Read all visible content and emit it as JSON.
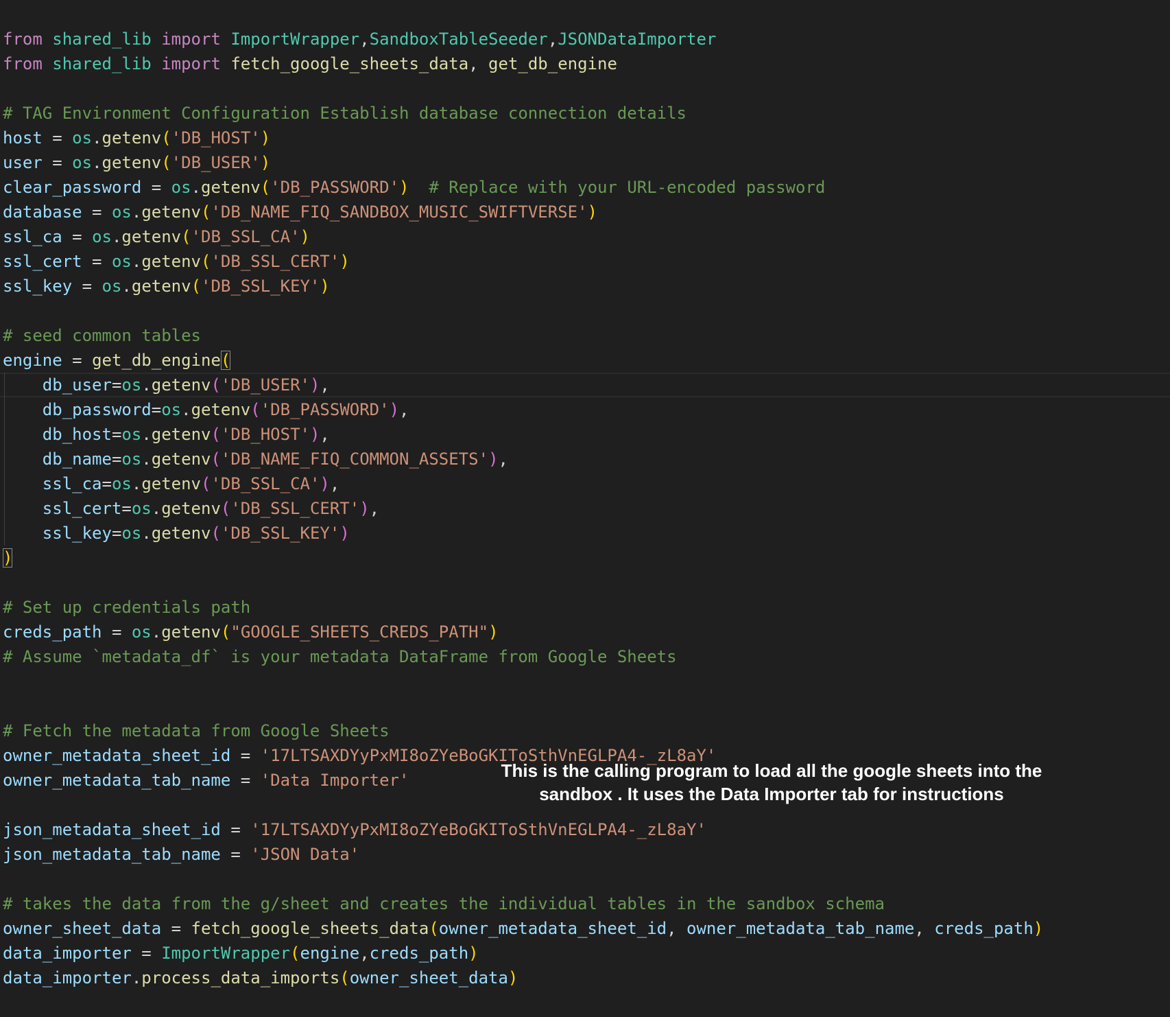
{
  "editor": {
    "colors": {
      "background": "#1f1f1f",
      "keyword": "#c586c0",
      "module": "#4ec9b0",
      "function": "#dcdcaa",
      "variable": "#9cdcfe",
      "string": "#ce9178",
      "comment": "#6a9955",
      "bracket_outer": "#ffd700",
      "bracket_inner": "#da70d6"
    },
    "lines": [
      [
        [
          "kw",
          "from"
        ],
        [
          "pl",
          " "
        ],
        [
          "mod",
          "shared_lib"
        ],
        [
          "pl",
          " "
        ],
        [
          "kw",
          "import"
        ],
        [
          "pl",
          " "
        ],
        [
          "cls",
          "ImportWrapper"
        ],
        [
          "pl",
          ","
        ],
        [
          "cls",
          "SandboxTableSeeder"
        ],
        [
          "pl",
          ","
        ],
        [
          "cls",
          "JSONDataImporter"
        ]
      ],
      [
        [
          "kw",
          "from"
        ],
        [
          "pl",
          " "
        ],
        [
          "mod",
          "shared_lib"
        ],
        [
          "pl",
          " "
        ],
        [
          "kw",
          "import"
        ],
        [
          "pl",
          " "
        ],
        [
          "fn",
          "fetch_google_sheets_data"
        ],
        [
          "pl",
          ", "
        ],
        [
          "fn",
          "get_db_engine"
        ]
      ],
      [],
      [
        [
          "cmt",
          "# TAG Environment Configuration Establish database connection details"
        ]
      ],
      [
        [
          "var",
          "host"
        ],
        [
          "pl",
          " = "
        ],
        [
          "mod",
          "os"
        ],
        [
          "pl",
          "."
        ],
        [
          "fn",
          "getenv"
        ],
        [
          "p1",
          "("
        ],
        [
          "str",
          "'DB_HOST'"
        ],
        [
          "p1",
          ")"
        ]
      ],
      [
        [
          "var",
          "user"
        ],
        [
          "pl",
          " = "
        ],
        [
          "mod",
          "os"
        ],
        [
          "pl",
          "."
        ],
        [
          "fn",
          "getenv"
        ],
        [
          "p1",
          "("
        ],
        [
          "str",
          "'DB_USER'"
        ],
        [
          "p1",
          ")"
        ]
      ],
      [
        [
          "var",
          "clear_password"
        ],
        [
          "pl",
          " = "
        ],
        [
          "mod",
          "os"
        ],
        [
          "pl",
          "."
        ],
        [
          "fn",
          "getenv"
        ],
        [
          "p1",
          "("
        ],
        [
          "str",
          "'DB_PASSWORD'"
        ],
        [
          "p1",
          ")"
        ],
        [
          "pl",
          "  "
        ],
        [
          "cmt",
          "# Replace with your URL-encoded password"
        ]
      ],
      [
        [
          "var",
          "database"
        ],
        [
          "pl",
          " = "
        ],
        [
          "mod",
          "os"
        ],
        [
          "pl",
          "."
        ],
        [
          "fn",
          "getenv"
        ],
        [
          "p1",
          "("
        ],
        [
          "str",
          "'DB_NAME_FIQ_SANDBOX_MUSIC_SWIFTVERSE'"
        ],
        [
          "p1",
          ")"
        ]
      ],
      [
        [
          "var",
          "ssl_ca"
        ],
        [
          "pl",
          " = "
        ],
        [
          "mod",
          "os"
        ],
        [
          "pl",
          "."
        ],
        [
          "fn",
          "getenv"
        ],
        [
          "p1",
          "("
        ],
        [
          "str",
          "'DB_SSL_CA'"
        ],
        [
          "p1",
          ")"
        ]
      ],
      [
        [
          "var",
          "ssl_cert"
        ],
        [
          "pl",
          " = "
        ],
        [
          "mod",
          "os"
        ],
        [
          "pl",
          "."
        ],
        [
          "fn",
          "getenv"
        ],
        [
          "p1",
          "("
        ],
        [
          "str",
          "'DB_SSL_CERT'"
        ],
        [
          "p1",
          ")"
        ]
      ],
      [
        [
          "var",
          "ssl_key"
        ],
        [
          "pl",
          " = "
        ],
        [
          "mod",
          "os"
        ],
        [
          "pl",
          "."
        ],
        [
          "fn",
          "getenv"
        ],
        [
          "p1",
          "("
        ],
        [
          "str",
          "'DB_SSL_KEY'"
        ],
        [
          "p1",
          ")"
        ]
      ],
      [],
      [
        [
          "cmt",
          "# seed common tables"
        ]
      ],
      [
        [
          "var",
          "engine"
        ],
        [
          "pl",
          " = "
        ],
        [
          "fn",
          "get_db_engine"
        ],
        [
          "p1hl",
          "("
        ]
      ],
      [
        [
          "pl",
          "    "
        ],
        [
          "var",
          "db_user"
        ],
        [
          "pl",
          "="
        ],
        [
          "mod",
          "os"
        ],
        [
          "pl",
          "."
        ],
        [
          "fn",
          "getenv"
        ],
        [
          "p2",
          "("
        ],
        [
          "str",
          "'DB_USER'"
        ],
        [
          "p2",
          ")"
        ],
        [
          "pl",
          ","
        ]
      ],
      [
        [
          "pl",
          "    "
        ],
        [
          "var",
          "db_password"
        ],
        [
          "pl",
          "="
        ],
        [
          "mod",
          "os"
        ],
        [
          "pl",
          "."
        ],
        [
          "fn",
          "getenv"
        ],
        [
          "p2",
          "("
        ],
        [
          "str",
          "'DB_PASSWORD'"
        ],
        [
          "p2",
          ")"
        ],
        [
          "pl",
          ","
        ]
      ],
      [
        [
          "pl",
          "    "
        ],
        [
          "var",
          "db_host"
        ],
        [
          "pl",
          "="
        ],
        [
          "mod",
          "os"
        ],
        [
          "pl",
          "."
        ],
        [
          "fn",
          "getenv"
        ],
        [
          "p2",
          "("
        ],
        [
          "str",
          "'DB_HOST'"
        ],
        [
          "p2",
          ")"
        ],
        [
          "pl",
          ","
        ]
      ],
      [
        [
          "pl",
          "    "
        ],
        [
          "var",
          "db_name"
        ],
        [
          "pl",
          "="
        ],
        [
          "mod",
          "os"
        ],
        [
          "pl",
          "."
        ],
        [
          "fn",
          "getenv"
        ],
        [
          "p2",
          "("
        ],
        [
          "str",
          "'DB_NAME_FIQ_COMMON_ASSETS'"
        ],
        [
          "p2",
          ")"
        ],
        [
          "pl",
          ","
        ]
      ],
      [
        [
          "pl",
          "    "
        ],
        [
          "var",
          "ssl_ca"
        ],
        [
          "pl",
          "="
        ],
        [
          "mod",
          "os"
        ],
        [
          "pl",
          "."
        ],
        [
          "fn",
          "getenv"
        ],
        [
          "p2",
          "("
        ],
        [
          "str",
          "'DB_SSL_CA'"
        ],
        [
          "p2",
          ")"
        ],
        [
          "pl",
          ","
        ]
      ],
      [
        [
          "pl",
          "    "
        ],
        [
          "var",
          "ssl_cert"
        ],
        [
          "pl",
          "="
        ],
        [
          "mod",
          "os"
        ],
        [
          "pl",
          "."
        ],
        [
          "fn",
          "getenv"
        ],
        [
          "p2",
          "("
        ],
        [
          "str",
          "'DB_SSL_CERT'"
        ],
        [
          "p2",
          ")"
        ],
        [
          "pl",
          ","
        ]
      ],
      [
        [
          "pl",
          "    "
        ],
        [
          "var",
          "ssl_key"
        ],
        [
          "pl",
          "="
        ],
        [
          "mod",
          "os"
        ],
        [
          "pl",
          "."
        ],
        [
          "fn",
          "getenv"
        ],
        [
          "p2",
          "("
        ],
        [
          "str",
          "'DB_SSL_KEY'"
        ],
        [
          "p2",
          ")"
        ]
      ],
      [
        [
          "p1hl",
          ")"
        ]
      ],
      [],
      [
        [
          "cmt",
          "# Set up credentials path"
        ]
      ],
      [
        [
          "var",
          "creds_path"
        ],
        [
          "pl",
          " = "
        ],
        [
          "mod",
          "os"
        ],
        [
          "pl",
          "."
        ],
        [
          "fn",
          "getenv"
        ],
        [
          "p1",
          "("
        ],
        [
          "str",
          "\"GOOGLE_SHEETS_CREDS_PATH\""
        ],
        [
          "p1",
          ")"
        ]
      ],
      [
        [
          "cmt",
          "# Assume `metadata_df` is your metadata DataFrame from Google Sheets"
        ]
      ],
      [],
      [],
      [
        [
          "cmt",
          "# Fetch the metadata from Google Sheets"
        ]
      ],
      [
        [
          "var",
          "owner_metadata_sheet_id"
        ],
        [
          "pl",
          " = "
        ],
        [
          "str",
          "'17LTSAXDYyPxMI8oZYeBoGKIToSthVnEGLPA4-_zL8aY'"
        ]
      ],
      [
        [
          "var",
          "owner_metadata_tab_name"
        ],
        [
          "pl",
          " = "
        ],
        [
          "str",
          "'Data Importer'"
        ]
      ],
      [],
      [
        [
          "var",
          "json_metadata_sheet_id"
        ],
        [
          "pl",
          " = "
        ],
        [
          "str",
          "'17LTSAXDYyPxMI8oZYeBoGKIToSthVnEGLPA4-_zL8aY'"
        ]
      ],
      [
        [
          "var",
          "json_metadata_tab_name"
        ],
        [
          "pl",
          " = "
        ],
        [
          "str",
          "'JSON Data'"
        ]
      ],
      [],
      [
        [
          "cmt",
          "# takes the data from the g/sheet and creates the individual tables in the sandbox schema"
        ]
      ],
      [
        [
          "var",
          "owner_sheet_data"
        ],
        [
          "pl",
          " = "
        ],
        [
          "fn",
          "fetch_google_sheets_data"
        ],
        [
          "p1",
          "("
        ],
        [
          "var",
          "owner_metadata_sheet_id"
        ],
        [
          "pl",
          ", "
        ],
        [
          "var",
          "owner_metadata_tab_name"
        ],
        [
          "pl",
          ", "
        ],
        [
          "var",
          "creds_path"
        ],
        [
          "p1",
          ")"
        ]
      ],
      [
        [
          "var",
          "data_importer"
        ],
        [
          "pl",
          " = "
        ],
        [
          "cls",
          "ImportWrapper"
        ],
        [
          "p1",
          "("
        ],
        [
          "var",
          "engine"
        ],
        [
          "pl",
          ","
        ],
        [
          "var",
          "creds_path"
        ],
        [
          "p1",
          ")"
        ]
      ],
      [
        [
          "var",
          "data_importer"
        ],
        [
          "pl",
          "."
        ],
        [
          "fn",
          "process_data_imports"
        ],
        [
          "p1",
          "("
        ],
        [
          "var",
          "owner_sheet_data"
        ],
        [
          "p1",
          ")"
        ]
      ]
    ]
  },
  "annotation": {
    "line1": "This is the calling program to load all the google sheets into the",
    "line2": "sandbox . It uses the Data Importer tab for instructions"
  }
}
